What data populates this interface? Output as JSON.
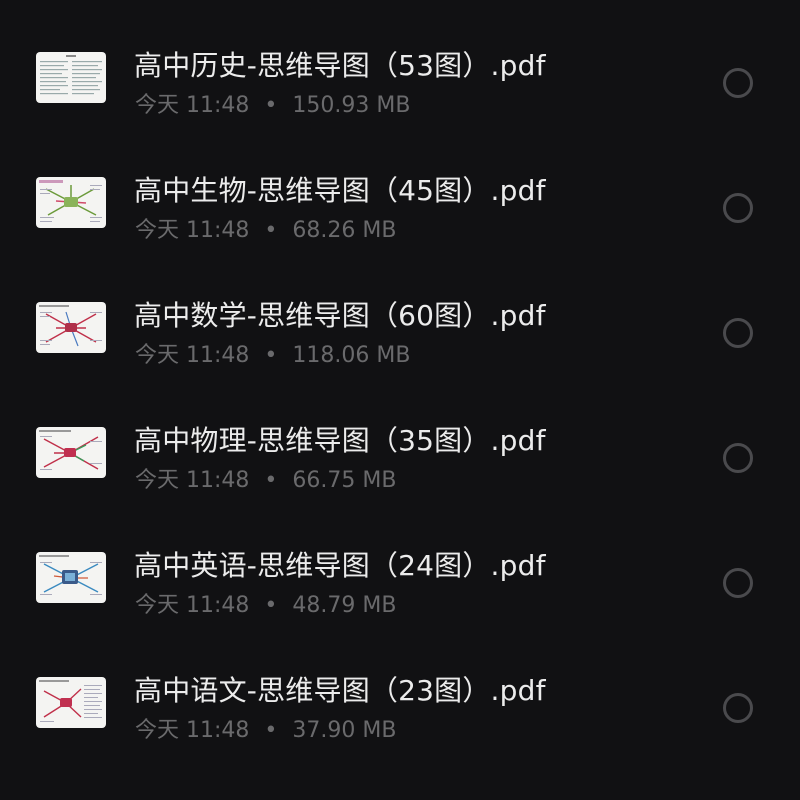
{
  "files": [
    {
      "name": "高中历史-思维导图（53图）.pdf",
      "date": "今天 11:48",
      "size": "150.93 MB",
      "thumb": "list"
    },
    {
      "name": "高中生物-思维导图（45图）.pdf",
      "date": "今天 11:48",
      "size": "68.26 MB",
      "thumb": "map-green"
    },
    {
      "name": "高中数学-思维导图（60图）.pdf",
      "date": "今天 11:48",
      "size": "118.06 MB",
      "thumb": "map-red"
    },
    {
      "name": "高中物理-思维导图（35图）.pdf",
      "date": "今天 11:48",
      "size": "66.75 MB",
      "thumb": "map-red"
    },
    {
      "name": "高中英语-思维导图（24图）.pdf",
      "date": "今天 11:48",
      "size": "48.79 MB",
      "thumb": "map-blue"
    },
    {
      "name": "高中语文-思维导图（23图）.pdf",
      "date": "今天 11:48",
      "size": "37.90 MB",
      "thumb": "map-red"
    }
  ],
  "colors": {
    "background": "#111113",
    "name_text": "#ececec",
    "meta_text": "#6a6a6c",
    "circle": "#4a4a4d"
  }
}
